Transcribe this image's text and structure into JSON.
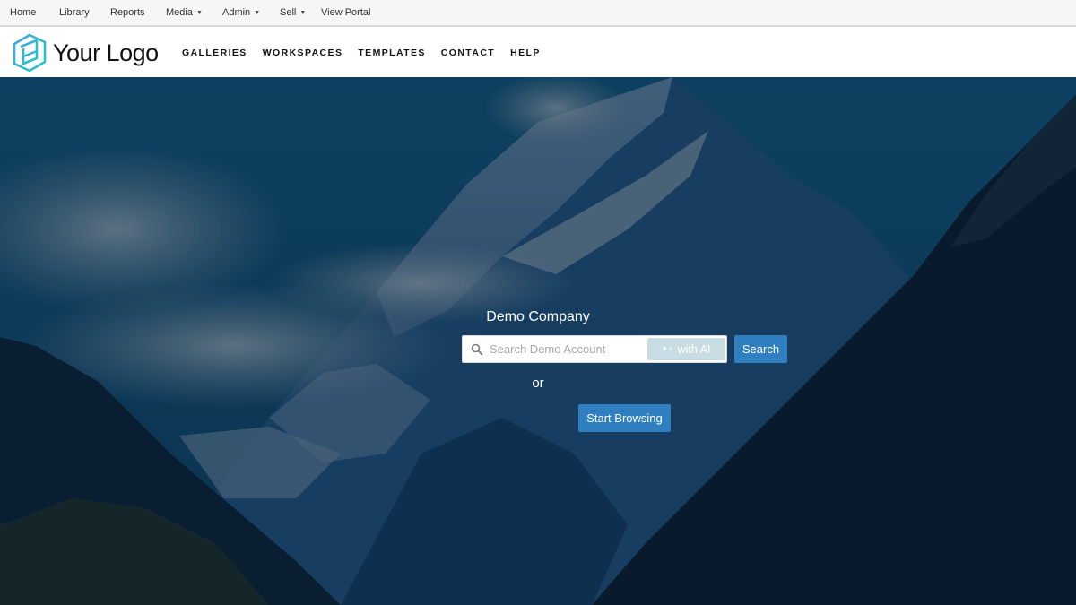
{
  "topbar": {
    "items": [
      {
        "label": "Home",
        "dropdown": false
      },
      {
        "label": "Library",
        "dropdown": false
      },
      {
        "label": "Reports",
        "dropdown": false
      },
      {
        "label": "Media",
        "dropdown": true
      },
      {
        "label": "Admin",
        "dropdown": true
      },
      {
        "label": "Sell",
        "dropdown": true
      },
      {
        "label": "View Portal",
        "dropdown": false
      }
    ]
  },
  "header": {
    "logo_text": "Your Logo",
    "logo_icon": "cube-logo-icon",
    "nav": [
      {
        "label": "GALLERIES"
      },
      {
        "label": "WORKSPACES"
      },
      {
        "label": "TEMPLATES"
      },
      {
        "label": "CONTACT"
      },
      {
        "label": "HELP"
      }
    ]
  },
  "hero": {
    "company_name": "Demo Company",
    "search": {
      "value": "",
      "placeholder": "Search Demo Account",
      "ai_button_label": "with AI",
      "ai_icon": "sparkle-icon",
      "submit_label": "Search"
    },
    "or_text": "or",
    "browse_label": "Start Browsing"
  },
  "colors": {
    "primary_button": "#2f7fc1",
    "ai_button": "#c8dde3",
    "logo_accent": "#2bb3d6",
    "topbar_bg": "#f6f6f6"
  }
}
